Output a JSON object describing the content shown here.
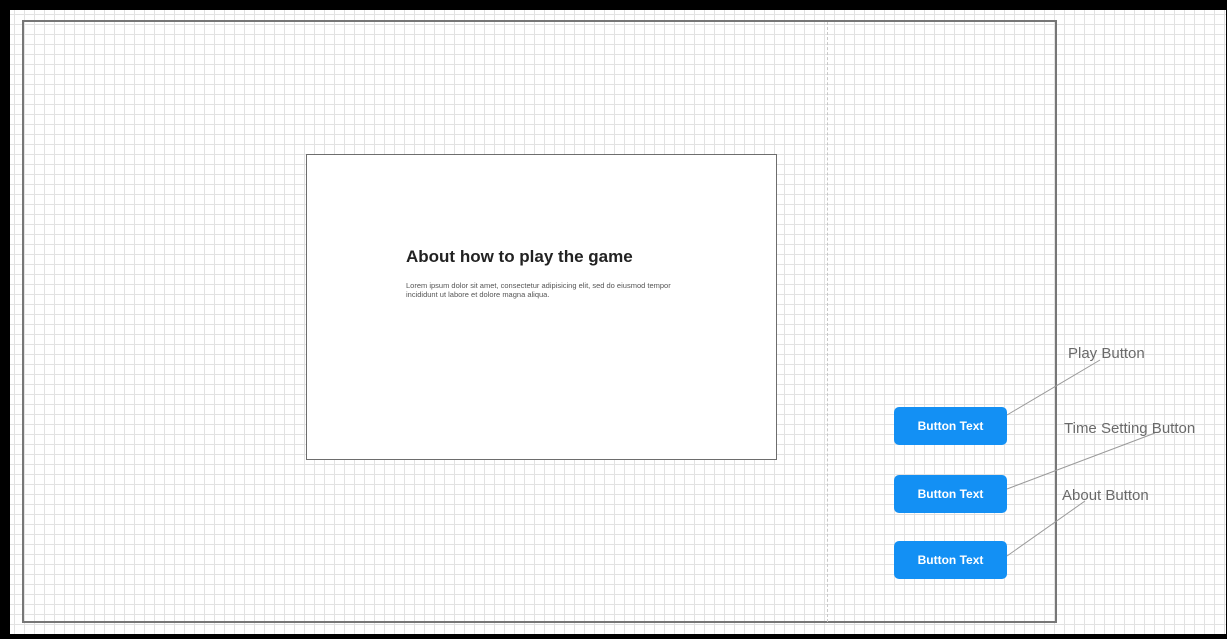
{
  "card": {
    "title": "About how to play the game",
    "body": "Lorem ipsum dolor sit amet, consectetur adipisicing elit, sed do eiusmod tempor incididunt ut labore et dolore magna aliqua."
  },
  "buttons": [
    {
      "label": "Button Text"
    },
    {
      "label": "Button Text"
    },
    {
      "label": "Button Text"
    }
  ],
  "annotations": [
    {
      "label": "Play Button"
    },
    {
      "label": "Time Setting Button"
    },
    {
      "label": "About Button"
    }
  ],
  "colors": {
    "button": "#1390f4",
    "connector": "#9a9a9a"
  }
}
